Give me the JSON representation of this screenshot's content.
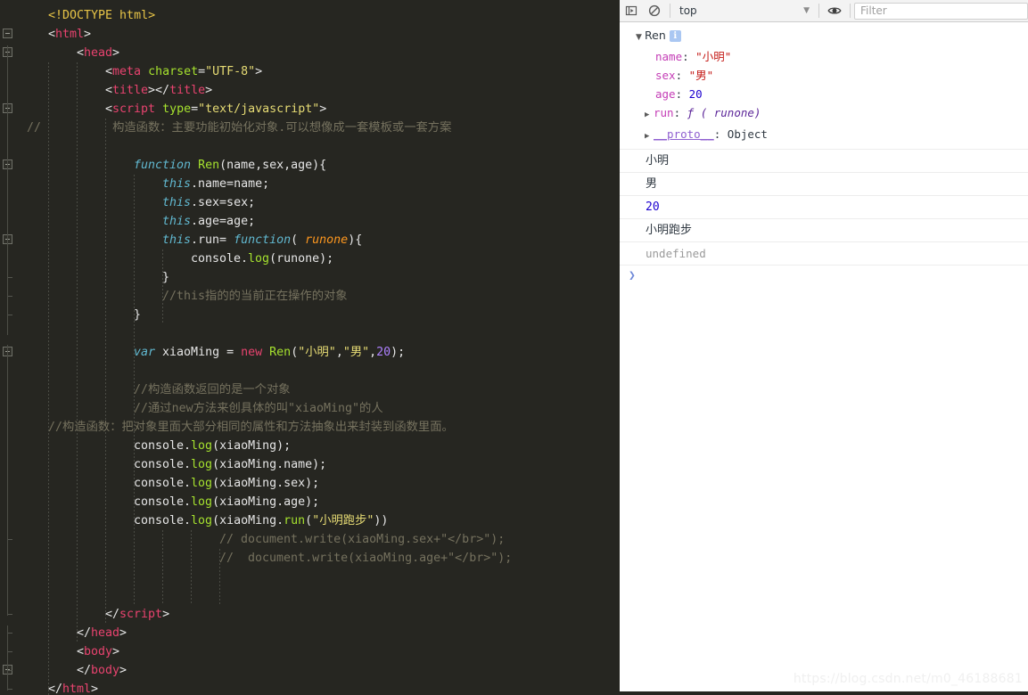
{
  "editor": {
    "language": "html",
    "background": "#262621",
    "lines": [
      {
        "indent": 1,
        "tokens": [
          {
            "c": "t-doctype",
            "t": "<!DOCTYPE html>"
          }
        ]
      },
      {
        "indent": 1,
        "tokens": [
          {
            "c": "t-punc",
            "t": "<"
          },
          {
            "c": "t-tag",
            "t": "html"
          },
          {
            "c": "t-punc",
            "t": ">"
          }
        ]
      },
      {
        "indent": 2,
        "tokens": [
          {
            "c": "t-punc",
            "t": "<"
          },
          {
            "c": "t-tag",
            "t": "head"
          },
          {
            "c": "t-punc",
            "t": ">"
          }
        ]
      },
      {
        "indent": 3,
        "tokens": [
          {
            "c": "t-punc",
            "t": "<"
          },
          {
            "c": "t-tag",
            "t": "meta"
          },
          {
            "c": "t-plain",
            "t": " "
          },
          {
            "c": "t-attr",
            "t": "charset"
          },
          {
            "c": "t-punc",
            "t": "="
          },
          {
            "c": "t-str",
            "t": "\"UTF-8\""
          },
          {
            "c": "t-punc",
            "t": ">"
          }
        ]
      },
      {
        "indent": 3,
        "tokens": [
          {
            "c": "t-punc",
            "t": "<"
          },
          {
            "c": "t-tag",
            "t": "title"
          },
          {
            "c": "t-punc",
            "t": "></"
          },
          {
            "c": "t-tag",
            "t": "title"
          },
          {
            "c": "t-punc",
            "t": ">"
          }
        ]
      },
      {
        "indent": 3,
        "tokens": [
          {
            "c": "t-punc",
            "t": "<"
          },
          {
            "c": "t-tag",
            "t": "script"
          },
          {
            "c": "t-plain",
            "t": " "
          },
          {
            "c": "t-attr",
            "t": "type"
          },
          {
            "c": "t-punc",
            "t": "="
          },
          {
            "c": "t-str",
            "t": "\"text/javascript\""
          },
          {
            "c": "t-punc",
            "t": ">"
          }
        ]
      },
      {
        "indent": 0,
        "tokens": [
          {
            "c": "t-comment",
            "t": " //          构造函数：主要功能初始化对象.可以想像成一套模板或一套方案"
          }
        ]
      },
      {
        "indent": 0,
        "tokens": []
      },
      {
        "indent": 4,
        "tokens": [
          {
            "c": "t-kw",
            "t": "function"
          },
          {
            "c": "t-plain",
            "t": " "
          },
          {
            "c": "t-fn",
            "t": "Ren"
          },
          {
            "c": "t-plain",
            "t": "(name,sex,age){"
          }
        ]
      },
      {
        "indent": 5,
        "tokens": [
          {
            "c": "t-this",
            "t": "this"
          },
          {
            "c": "t-plain",
            "t": ".name=name;"
          }
        ]
      },
      {
        "indent": 5,
        "tokens": [
          {
            "c": "t-this",
            "t": "this"
          },
          {
            "c": "t-plain",
            "t": ".sex=sex;"
          }
        ]
      },
      {
        "indent": 5,
        "tokens": [
          {
            "c": "t-this",
            "t": "this"
          },
          {
            "c": "t-plain",
            "t": ".age=age;"
          }
        ]
      },
      {
        "indent": 5,
        "tokens": [
          {
            "c": "t-this",
            "t": "this"
          },
          {
            "c": "t-plain",
            "t": ".run= "
          },
          {
            "c": "t-kw",
            "t": "function"
          },
          {
            "c": "t-plain",
            "t": "( "
          },
          {
            "c": "t-param",
            "t": "runone"
          },
          {
            "c": "t-plain",
            "t": "){"
          }
        ]
      },
      {
        "indent": 6,
        "tokens": [
          {
            "c": "t-plain",
            "t": "console."
          },
          {
            "c": "t-fn",
            "t": "log"
          },
          {
            "c": "t-plain",
            "t": "(runone);"
          }
        ]
      },
      {
        "indent": 5,
        "tokens": [
          {
            "c": "t-plain",
            "t": "}"
          }
        ]
      },
      {
        "indent": 5,
        "tokens": [
          {
            "c": "t-comment",
            "t": "//this指的的当前正在操作的对象"
          }
        ]
      },
      {
        "indent": 4,
        "tokens": [
          {
            "c": "t-plain",
            "t": "}"
          }
        ]
      },
      {
        "indent": 0,
        "tokens": []
      },
      {
        "indent": 4,
        "tokens": [
          {
            "c": "t-kw",
            "t": "var"
          },
          {
            "c": "t-plain",
            "t": " xiaoMing = "
          },
          {
            "c": "t-kw2",
            "t": "new"
          },
          {
            "c": "t-plain",
            "t": " "
          },
          {
            "c": "t-fn",
            "t": "Ren"
          },
          {
            "c": "t-plain",
            "t": "("
          },
          {
            "c": "t-str",
            "t": "\"小明\""
          },
          {
            "c": "t-plain",
            "t": ","
          },
          {
            "c": "t-str",
            "t": "\"男\""
          },
          {
            "c": "t-plain",
            "t": ","
          },
          {
            "c": "t-num",
            "t": "20"
          },
          {
            "c": "t-plain",
            "t": ");"
          }
        ]
      },
      {
        "indent": 0,
        "tokens": []
      },
      {
        "indent": 4,
        "tokens": [
          {
            "c": "t-comment",
            "t": "//构造函数返回的是一个对象"
          }
        ]
      },
      {
        "indent": 4,
        "tokens": [
          {
            "c": "t-comment",
            "t": "//通过new方法来创具体的叫\"xiaoMing\"的人"
          }
        ]
      },
      {
        "indent": 1,
        "tokens": [
          {
            "c": "t-comment",
            "t": "//构造函数：把对象里面大部分相同的属性和方法抽象出来封装到函数里面。"
          }
        ]
      },
      {
        "indent": 4,
        "tokens": [
          {
            "c": "t-plain",
            "t": "console."
          },
          {
            "c": "t-fn",
            "t": "log"
          },
          {
            "c": "t-plain",
            "t": "(xiaoMing);"
          }
        ]
      },
      {
        "indent": 4,
        "tokens": [
          {
            "c": "t-plain",
            "t": "console."
          },
          {
            "c": "t-fn",
            "t": "log"
          },
          {
            "c": "t-plain",
            "t": "(xiaoMing.name);"
          }
        ]
      },
      {
        "indent": 4,
        "tokens": [
          {
            "c": "t-plain",
            "t": "console."
          },
          {
            "c": "t-fn",
            "t": "log"
          },
          {
            "c": "t-plain",
            "t": "(xiaoMing.sex);"
          }
        ]
      },
      {
        "indent": 4,
        "tokens": [
          {
            "c": "t-plain",
            "t": "console."
          },
          {
            "c": "t-fn",
            "t": "log"
          },
          {
            "c": "t-plain",
            "t": "(xiaoMing.age);"
          }
        ]
      },
      {
        "indent": 4,
        "tokens": [
          {
            "c": "t-plain",
            "t": "console."
          },
          {
            "c": "t-fn",
            "t": "log"
          },
          {
            "c": "t-plain",
            "t": "(xiaoMing."
          },
          {
            "c": "t-fn",
            "t": "run"
          },
          {
            "c": "t-plain",
            "t": "("
          },
          {
            "c": "t-str",
            "t": "\"小明跑步\""
          },
          {
            "c": "t-plain",
            "t": "))"
          }
        ]
      },
      {
        "indent": 7,
        "tokens": [
          {
            "c": "t-comment",
            "t": "// document.write(xiaoMing.sex+\"</br>\");"
          }
        ]
      },
      {
        "indent": 7,
        "tokens": [
          {
            "c": "t-comment",
            "t": "//  document.write(xiaoMing.age+\"</br>\");"
          }
        ]
      },
      {
        "indent": 0,
        "tokens": []
      },
      {
        "indent": 0,
        "tokens": []
      },
      {
        "indent": 3,
        "tokens": [
          {
            "c": "t-punc",
            "t": "</"
          },
          {
            "c": "t-tag",
            "t": "script"
          },
          {
            "c": "t-punc",
            "t": ">"
          }
        ]
      },
      {
        "indent": 2,
        "tokens": [
          {
            "c": "t-punc",
            "t": "</"
          },
          {
            "c": "t-tag",
            "t": "head"
          },
          {
            "c": "t-punc",
            "t": ">"
          }
        ]
      },
      {
        "indent": 2,
        "tokens": [
          {
            "c": "t-punc",
            "t": "<"
          },
          {
            "c": "t-tag",
            "t": "body"
          },
          {
            "c": "t-punc",
            "t": ">"
          }
        ]
      },
      {
        "indent": 2,
        "tokens": [
          {
            "c": "t-punc",
            "t": "</"
          },
          {
            "c": "t-tag",
            "t": "body"
          },
          {
            "c": "t-punc",
            "t": ">"
          }
        ]
      },
      {
        "indent": 1,
        "tokens": [
          {
            "c": "t-punc",
            "t": "</"
          },
          {
            "c": "t-tag",
            "t": "html"
          },
          {
            "c": "t-punc",
            "t": ">"
          }
        ]
      }
    ],
    "fold_markers": [
      1,
      2,
      5,
      8,
      12,
      18,
      35
    ],
    "fold_ends": [
      14,
      15,
      16,
      28,
      32,
      33,
      34,
      35,
      36
    ]
  },
  "devtools": {
    "toolbar": {
      "sidebar_toggle_icon": "sidebar-toggle-icon",
      "clear_console_icon": "clear-console-icon",
      "context_label": "top",
      "caret_icon": "chevron-down-icon",
      "eye_icon": "eye-icon",
      "filter_placeholder": "Filter"
    },
    "console": {
      "object_log": {
        "expand_icon": "triangle-down-icon",
        "constructor": "Ren",
        "info_badge": "i",
        "properties": [
          {
            "key": "name",
            "sep": ": ",
            "value": "\"小明\"",
            "value_class": "p-str",
            "expandable": false
          },
          {
            "key": "sex",
            "sep": ": ",
            "value": "\"男\"",
            "value_class": "p-str",
            "expandable": false
          },
          {
            "key": "age",
            "sep": ": ",
            "value": "20",
            "value_class": "p-num",
            "expandable": false
          },
          {
            "key": "run",
            "sep": ": ",
            "value": "ƒ ( runone)",
            "value_class": "p-fn",
            "expandable": true
          },
          {
            "key": "__proto__",
            "sep": ": ",
            "value": "Object",
            "value_class": "p-obj",
            "expandable": true,
            "key_class": "p-key-proto"
          }
        ]
      },
      "log_rows": [
        {
          "text": "小明",
          "style": "text"
        },
        {
          "text": "男",
          "style": "text"
        },
        {
          "text": "20",
          "style": "num"
        },
        {
          "text": "小明跑步",
          "style": "text"
        },
        {
          "text": "undefined",
          "style": "undef"
        }
      ],
      "prompt": "❯"
    },
    "watermark": "https://blog.csdn.net/m0_46188681"
  },
  "colors": {
    "editor_bg": "#262621",
    "devtools_bg": "#ffffff",
    "toolbar_bg": "#f3f3f3",
    "accent_blue": "#6e88d8",
    "string_red": "#c41a16",
    "number_blue": "#1c00cf",
    "key_magenta": "#c43db6"
  }
}
